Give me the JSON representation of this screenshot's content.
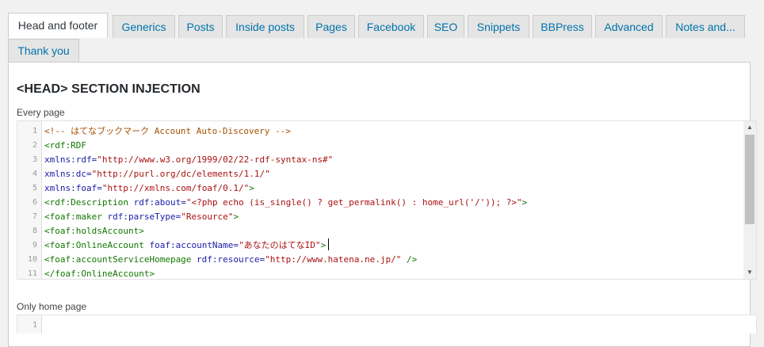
{
  "tabs": [
    {
      "label": "Head and footer",
      "active": true
    },
    {
      "label": "Generics"
    },
    {
      "label": "Posts"
    },
    {
      "label": "Inside posts"
    },
    {
      "label": "Pages"
    },
    {
      "label": "Facebook"
    },
    {
      "label": "SEO"
    },
    {
      "label": "Snippets"
    },
    {
      "label": "BBPress"
    },
    {
      "label": "Advanced"
    },
    {
      "label": "Notes and..."
    },
    {
      "label": "Thank you"
    }
  ],
  "section": {
    "title": "<HEAD> SECTION INJECTION",
    "every_page": {
      "label": "Every page",
      "line_numbers": [
        "1",
        "2",
        "3",
        "4",
        "5",
        "6",
        "7",
        "8",
        "9",
        "10",
        "11"
      ],
      "lines": [
        [
          {
            "t": "<!-- はてなブックマーク Account Auto-Discovery -->",
            "c": "comment"
          }
        ],
        [
          {
            "t": "<rdf:RDF",
            "c": "tag"
          }
        ],
        [
          {
            "t": "xmlns:rdf=",
            "c": "attr"
          },
          {
            "t": "\"http://www.w3.org/1999/02/22-rdf-syntax-ns#\"",
            "c": "str"
          }
        ],
        [
          {
            "t": "xmlns:dc=",
            "c": "attr"
          },
          {
            "t": "\"http://purl.org/dc/elements/1.1/\"",
            "c": "str"
          }
        ],
        [
          {
            "t": "xmlns:foaf=",
            "c": "attr"
          },
          {
            "t": "\"http://xmlns.com/foaf/0.1/\"",
            "c": "str"
          },
          {
            "t": ">",
            "c": "tag"
          }
        ],
        [
          {
            "t": "<rdf:Description",
            "c": "tag"
          },
          {
            "t": " rdf:about=",
            "c": "attr"
          },
          {
            "t": "\"<?php echo (is_single() ? get_permalink() : home_url('/')); ?>\"",
            "c": "str"
          },
          {
            "t": ">",
            "c": "tag"
          }
        ],
        [
          {
            "t": "<foaf:maker",
            "c": "tag"
          },
          {
            "t": " rdf:parseType=",
            "c": "attr"
          },
          {
            "t": "\"Resource\"",
            "c": "str"
          },
          {
            "t": ">",
            "c": "tag"
          }
        ],
        [
          {
            "t": "<foaf:holdsAccount>",
            "c": "tag"
          }
        ],
        [
          {
            "t": "<foaf:OnlineAccount",
            "c": "tag"
          },
          {
            "t": " foaf:accountName=",
            "c": "attr"
          },
          {
            "t": "\"あなたのはてなID\"",
            "c": "str"
          },
          {
            "t": ">",
            "c": "tag"
          }
        ],
        [
          {
            "t": "<foaf:accountServiceHomepage",
            "c": "tag"
          },
          {
            "t": " rdf:resource=",
            "c": "attr"
          },
          {
            "t": "\"http://www.hatena.ne.jp/\"",
            "c": "str"
          },
          {
            "t": " />",
            "c": "tag"
          }
        ],
        [
          {
            "t": "</foaf:OnlineAccount>",
            "c": "tag"
          }
        ]
      ]
    },
    "home_page": {
      "label": "Only home page",
      "line_numbers": [
        "1"
      ]
    }
  },
  "icons": {
    "scroll_up": "▲",
    "scroll_down": "▼"
  },
  "colors": {
    "link": "#0073aa",
    "tab_bg": "#e5e5e5",
    "panel_bg": "#ffffff",
    "page_bg": "#f1f1f1"
  }
}
